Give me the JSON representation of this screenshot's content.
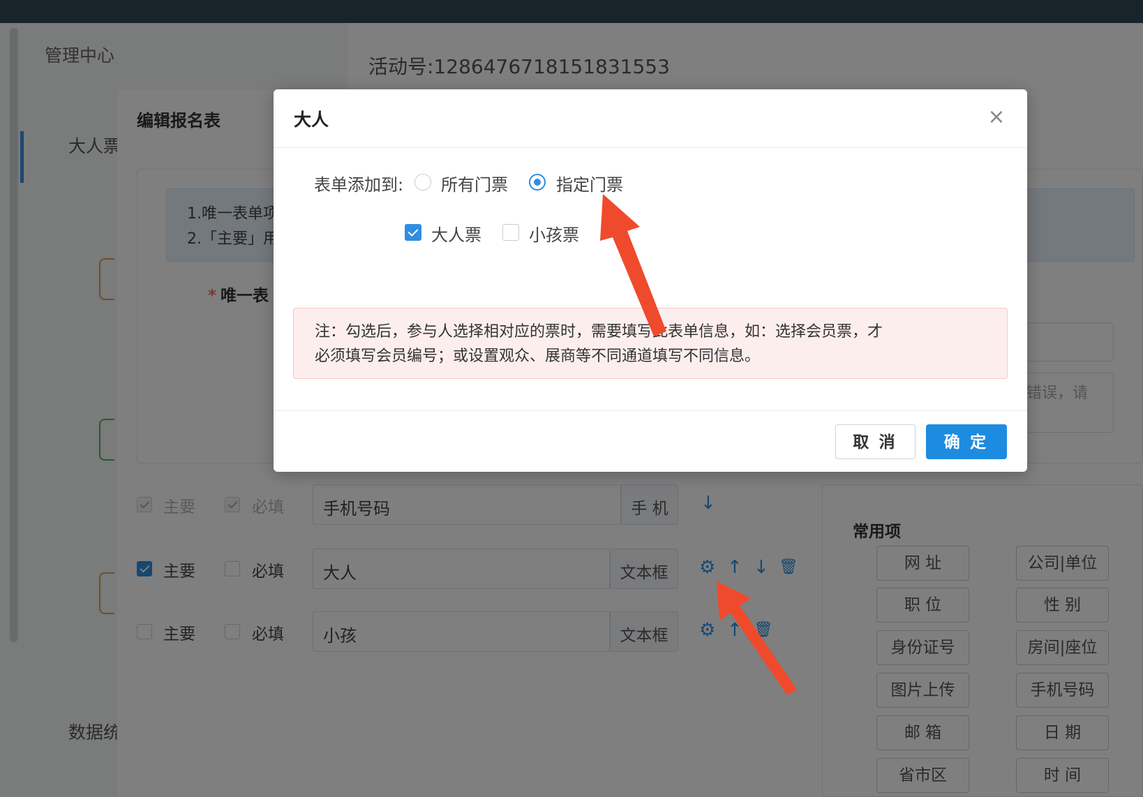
{
  "app": {
    "admin_title": "管理中心",
    "event_number": "活动号:1286476718151831553",
    "nav_adult": "大人票",
    "nav_data": "数据统计"
  },
  "form_panel": {
    "title": "编辑报名表",
    "tips": [
      "1.唯一表单项",
      "2.「主要」用"
    ],
    "required_label": "唯一表",
    "textarea_hint": "错误，请",
    "rows": [
      {
        "primary_label": "主要",
        "required_label": "必填",
        "primary_checked": true,
        "required_checked": true,
        "disabled": true,
        "value": "手机号码",
        "type": "手 机"
      },
      {
        "primary_label": "主要",
        "required_label": "必填",
        "primary_checked": true,
        "required_checked": false,
        "disabled": false,
        "value": "大人",
        "type": "文本框"
      },
      {
        "primary_label": "主要",
        "required_label": "必填",
        "primary_checked": false,
        "required_checked": false,
        "disabled": false,
        "value": "小孩",
        "type": "文本框"
      }
    ],
    "controls": {
      "gear": "⚙",
      "up": "↑",
      "down": "↓",
      "delete": "🗑"
    }
  },
  "common_items": {
    "title": "常用项",
    "items": [
      "网 址",
      "公司|单位",
      "职 位",
      "性 别",
      "身份证号",
      "房间|座位",
      "图片上传",
      "手机号码",
      "邮 箱",
      "日 期",
      "省市区",
      "时 间"
    ]
  },
  "dialog": {
    "title": "大人",
    "close_icon": "×",
    "add_to_label": "表单添加到:",
    "radio_options": [
      {
        "label": "所有门票",
        "checked": false
      },
      {
        "label": "指定门票",
        "checked": true
      }
    ],
    "ticket_options": [
      {
        "label": "大人票",
        "checked": true
      },
      {
        "label": "小孩票",
        "checked": false
      }
    ],
    "note_line1": "注：勾选后，参与人选择相对应的票时，需要填写此表单信息，如：选择会员票，才",
    "note_line2": "必须填写会员编号；或设置观众、展商等不同通道填写不同信息。",
    "cancel_label": "取 消",
    "confirm_label": "确 定"
  },
  "colors": {
    "primary": "#1d8ce0",
    "arrow": "#f04a2c",
    "note_bg": "#fdeeee",
    "topbar": "#2f4b54"
  }
}
